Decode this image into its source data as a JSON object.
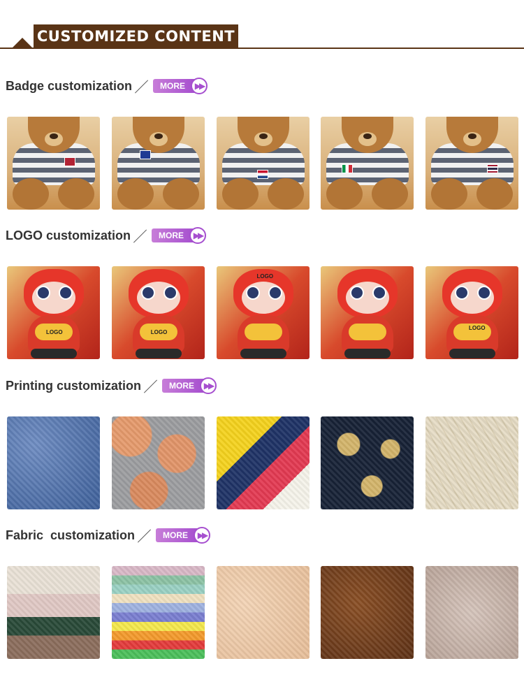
{
  "header": {
    "title": "CUSTOMIZED CONTENT"
  },
  "more_label": "MORE",
  "sections": [
    {
      "title": "Badge customization",
      "tiles": [
        {
          "name": "bear-badge-usa",
          "badge_color": "#b22234"
        },
        {
          "name": "bear-badge-uk",
          "badge_color": "#1f3a93"
        },
        {
          "name": "bear-badge-netherlands",
          "badge_color": "#c8102e"
        },
        {
          "name": "bear-badge-italy",
          "badge_color": "#009246"
        },
        {
          "name": "bear-badge-thailand",
          "badge_color": "#241d4f"
        }
      ]
    },
    {
      "title": "LOGO customization",
      "logo_text": "LOGO",
      "tiles": [
        {
          "name": "dragon-logo-belly"
        },
        {
          "name": "dragon-logo-bag"
        },
        {
          "name": "dragon-logo-head"
        },
        {
          "name": "dragon-logo-plain"
        },
        {
          "name": "dragon-logo-chest"
        }
      ]
    },
    {
      "title": "Printing customization",
      "tiles": [
        {
          "name": "print-denim-embroidery"
        },
        {
          "name": "print-rose-pattern"
        },
        {
          "name": "print-cartoon"
        },
        {
          "name": "print-gold-leopard"
        },
        {
          "name": "print-embossed-hexagon"
        }
      ]
    },
    {
      "title": "Fabric  customization",
      "tiles": [
        {
          "name": "fabric-fleece-stack"
        },
        {
          "name": "fabric-color-stack"
        },
        {
          "name": "fabric-beige-plush"
        },
        {
          "name": "fabric-brown-curly"
        },
        {
          "name": "fabric-grey-shaggy"
        }
      ]
    }
  ]
}
